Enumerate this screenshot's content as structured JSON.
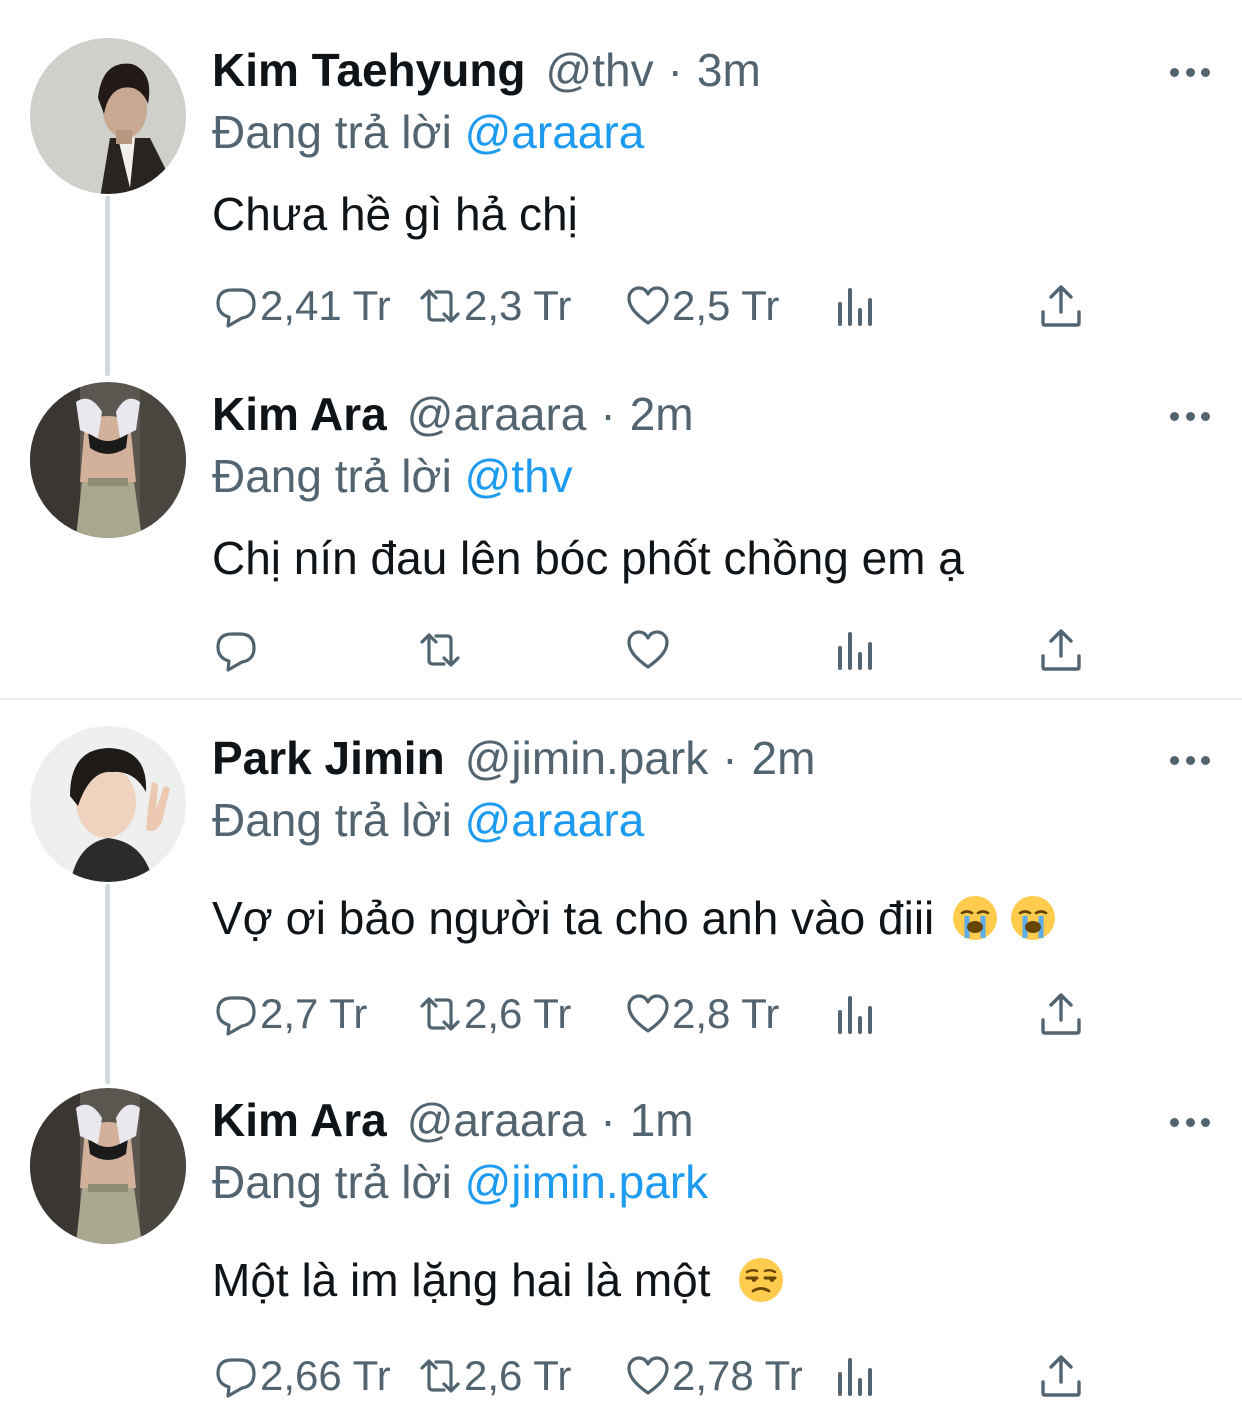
{
  "colors": {
    "name": "#0f1419",
    "muted": "#536471",
    "mention": "#1d9bf0",
    "thread_line": "#cfd9de",
    "divider": "#e6ecf0"
  },
  "replying_prefix": "Đang trả lời",
  "tweets": [
    {
      "name": "Kim Taehyung",
      "handle": "@thv",
      "separator": "·",
      "time": "3m",
      "reply_to": "@araara",
      "text": "Chưa hề gì hả chị",
      "replies": "2,41 Tr",
      "retweets": "2,3 Tr",
      "likes": "2,5 Tr",
      "emoji": []
    },
    {
      "name": "Kim Ara",
      "handle": "@araara",
      "separator": "·",
      "time": "2m",
      "reply_to": "@thv",
      "text": "Chị nín đau lên bóc phốt chồng em ạ",
      "replies": "",
      "retweets": "",
      "likes": "",
      "emoji": []
    },
    {
      "name": "Park Jimin",
      "handle": "@jimin.park",
      "separator": "·",
      "time": "2m",
      "reply_to": "@araara",
      "text": "Vợ ơi bảo người ta cho anh vào điii",
      "replies": "2,7 Tr",
      "retweets": "2,6 Tr",
      "likes": "2,8 Tr",
      "emoji": [
        "loudly-crying-face-emoji",
        "loudly-crying-face-emoji"
      ]
    },
    {
      "name": "Kim Ara",
      "handle": "@araara",
      "separator": "·",
      "time": "1m",
      "reply_to": "@jimin.park",
      "text": "Một là im lặng hai là một",
      "replies": "2,66 Tr",
      "retweets": "2,6 Tr",
      "likes": "2,78 Tr",
      "emoji": [
        "unamused-face-emoji"
      ]
    }
  ]
}
